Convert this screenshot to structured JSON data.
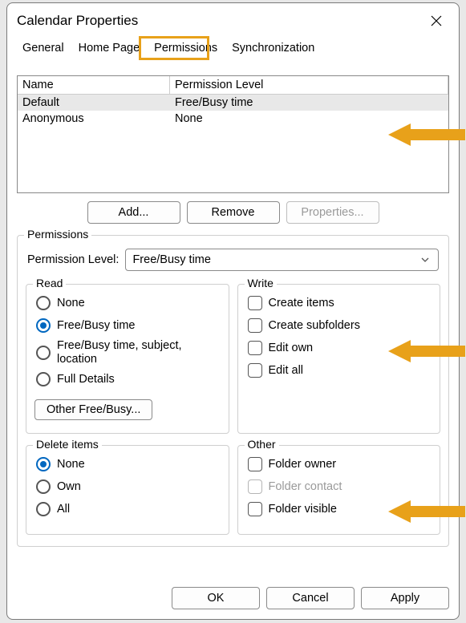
{
  "window": {
    "title": "Calendar Properties"
  },
  "tabs": {
    "general": "General",
    "home_page": "Home Page",
    "permissions": "Permissions",
    "synchronization": "Synchronization"
  },
  "list": {
    "header_name": "Name",
    "header_level": "Permission Level",
    "rows": [
      {
        "name": "Default",
        "level": "Free/Busy time"
      },
      {
        "name": "Anonymous",
        "level": "None"
      }
    ]
  },
  "buttons": {
    "add": "Add...",
    "remove": "Remove",
    "properties": "Properties...",
    "other_free_busy": "Other Free/Busy...",
    "ok": "OK",
    "cancel": "Cancel",
    "apply": "Apply"
  },
  "permissions_group": {
    "legend": "Permissions",
    "level_label": "Permission Level:",
    "level_value": "Free/Busy time"
  },
  "read": {
    "legend": "Read",
    "none": "None",
    "free_busy": "Free/Busy time",
    "free_busy_subject": "Free/Busy time, subject, location",
    "full_details": "Full Details"
  },
  "write": {
    "legend": "Write",
    "create_items": "Create items",
    "create_subfolders": "Create subfolders",
    "edit_own": "Edit own",
    "edit_all": "Edit all"
  },
  "delete": {
    "legend": "Delete items",
    "none": "None",
    "own": "Own",
    "all": "All"
  },
  "other": {
    "legend": "Other",
    "folder_owner": "Folder owner",
    "folder_contact": "Folder contact",
    "folder_visible": "Folder visible"
  },
  "colors": {
    "highlight": "#e8a11a",
    "accent": "#0067c0"
  }
}
